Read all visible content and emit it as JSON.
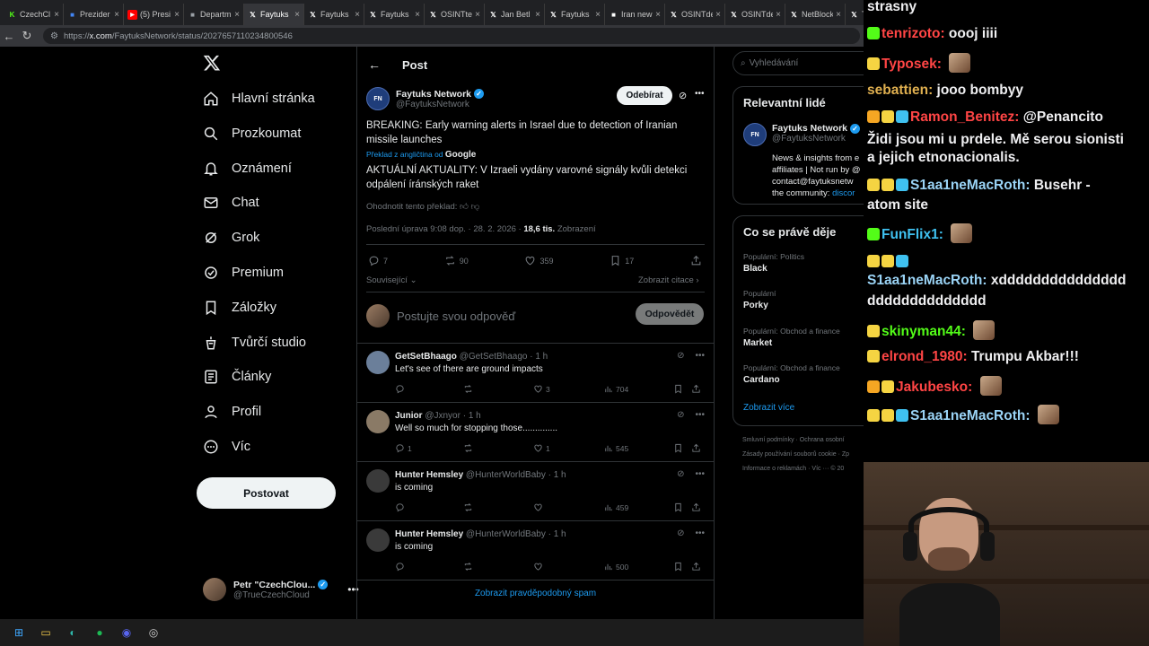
{
  "browser": {
    "tabs": [
      {
        "label": "CzechCl",
        "icon": "kick-icon",
        "color": "#53fc18"
      },
      {
        "label": "Prezider",
        "icon": "app-icon",
        "color": "#4285f4"
      },
      {
        "label": "(5) Presi",
        "icon": "youtube-icon",
        "color": "#ff0000"
      },
      {
        "label": "Departm",
        "icon": "generic-page-icon",
        "color": "#9aa0a6"
      },
      {
        "label": "Faytuks",
        "icon": "x-icon",
        "color": "#ffffff"
      },
      {
        "label": "Faytuks",
        "icon": "x-icon",
        "color": "#ffffff"
      },
      {
        "label": "Faytuks",
        "icon": "x-icon",
        "color": "#ffffff"
      },
      {
        "label": "OSINTte",
        "icon": "x-icon",
        "color": "#ffffff"
      },
      {
        "label": "Jan Betl",
        "icon": "x-icon",
        "color": "#ffffff"
      },
      {
        "label": "Faytuks",
        "icon": "x-icon",
        "color": "#ffffff"
      },
      {
        "label": "Iran new",
        "icon": "news-icon",
        "color": "#ffffff"
      },
      {
        "label": "OSINTde",
        "icon": "x-icon",
        "color": "#ffffff"
      },
      {
        "label": "OSINTde",
        "icon": "x-icon",
        "color": "#ffffff"
      },
      {
        "label": "NetBlock",
        "icon": "x-icon",
        "color": "#ffffff"
      },
      {
        "label": "T",
        "icon": "x-icon",
        "color": "#ffffff"
      }
    ],
    "url_prefix": "https://",
    "url_host": "x.com",
    "url_path": "/FaytuksNetwork/status/2027657110234800546"
  },
  "nav": {
    "items": [
      "Hlavní stránka",
      "Prozkoumat",
      "Oznámení",
      "Chat",
      "Grok",
      "Premium",
      "Záložky",
      "Tvůrčí studio",
      "Články",
      "Profil",
      "Víc"
    ],
    "post_button": "Postovat",
    "user_name": "Petr \"CzechClou...",
    "user_handle": "@TrueCzechCloud"
  },
  "main": {
    "header": "Post",
    "author_name": "Faytuks Network",
    "author_handle": "@FaytuksNetwork",
    "avatar_text": "FN",
    "subscribe": "Odebírat",
    "text": "BREAKING: Early warning alerts in Israel due to detection of Iranian missile launches",
    "translated_from": "Překlad z angličtina od",
    "google": "Google",
    "translation": "AKTUÁLNÍ AKTUALITY: V Izraeli vydány varovné signály kvůli detekci odpálení íránských raket",
    "rate": "Ohodnotit tento překlad:",
    "edited": "Poslední úprava 9:08 dop. · 28. 2. 2026 ·",
    "views": "18,6 tis.",
    "views_label": "Zobrazení",
    "replies": "7",
    "reposts": "90",
    "likes": "359",
    "bookmarks": "17",
    "related": "Související",
    "quotes": "Zobrazit citace",
    "reply_placeholder": "Postujte svou odpověď",
    "reply_button": "Odpovědět",
    "spam": "Zobrazit pravděpodobný spam"
  },
  "replies": [
    {
      "name": "GetSetBhaago",
      "handle": "@GetSetBhaago · 1 h",
      "text": "Let's see of there are ground impacts",
      "replies": "",
      "reposts": "",
      "likes": "3",
      "views": "704"
    },
    {
      "name": "Junior",
      "handle": "@Jxnyor · 1 h",
      "text": "Well so much for stopping those..............",
      "replies": "1",
      "reposts": "",
      "likes": "1",
      "views": "545"
    },
    {
      "name": "Hunter Hemsley",
      "handle": "@HunterWorldBaby · 1 h",
      "text": "is coming",
      "replies": "",
      "reposts": "",
      "likes": "",
      "views": "459"
    },
    {
      "name": "Hunter Hemsley",
      "handle": "@HunterWorldBaby · 1 h",
      "text": "is coming",
      "replies": "",
      "reposts": "",
      "likes": "",
      "views": "500"
    }
  ],
  "right": {
    "search": "Vyhledávání",
    "relevant_title": "Relevantní lidé",
    "rel_name": "Faytuks Network",
    "rel_handle": "@FaytuksNetwork",
    "rel_bio1": "News & insights from e",
    "rel_bio2": "affiliates | Not run by @",
    "rel_bio3": "contact@faytuksnetw",
    "rel_bio4": "the community:",
    "rel_link": "discor",
    "trends_title": "Co se právě děje",
    "trends": [
      {
        "top": "Populární: Politics",
        "name": "Black"
      },
      {
        "top": "Populární",
        "name": "Porky"
      },
      {
        "top": "Populární: Obchod a finance",
        "name": "Market"
      },
      {
        "top": "Populární: Obchod a finance",
        "name": "Cardano"
      }
    ],
    "show_more": "Zobrazit více",
    "footer1": "Smluvní podmínky · Ochrana osobní",
    "footer2": "Zásady používání souborů cookie · Zp",
    "footer3": "Informace o reklamách · Víc ··· © 20"
  },
  "chat": [
    {
      "user": "",
      "color": "#efeff1",
      "msg": "strasny",
      "badges": []
    },
    {
      "user": "tenrizoto",
      "color": "#ff4545",
      "msg": "oooj iiii",
      "badges": [
        "#53fc18"
      ]
    },
    {
      "user": "Typosek",
      "color": "#ff4545",
      "msg": "",
      "badges": [
        "#f5d442"
      ],
      "emote": true
    },
    {
      "user": "sebattien",
      "color": "#e0b050",
      "msg": "jooo bombyy",
      "badges": []
    },
    {
      "user": "Ramon_Benitez",
      "color": "#ff4545",
      "msg": "@Penancito",
      "badges": [
        "#f5a623",
        "#f5d442",
        "#3fc1f0"
      ]
    },
    {
      "user": "",
      "color": "#efeff1",
      "msg": "Židi jsou mi u prdele. Mě serou sionisti",
      "badges": []
    },
    {
      "user": "",
      "color": "#efeff1",
      "msg": "a jejich etnonacionalis.",
      "badges": []
    },
    {
      "user": "S1aa1neMacRoth",
      "color": "#9ad3f5",
      "msg": "Busehr -",
      "badges": [
        "#f5d442",
        "#f5d442",
        "#3fc1f0"
      ]
    },
    {
      "user": "",
      "color": "#efeff1",
      "msg": "atom site",
      "badges": []
    },
    {
      "user": "FunFlix1",
      "color": "#3fc1f0",
      "msg": "",
      "badges": [
        "#53fc18"
      ],
      "emote": true
    },
    {
      "user": "",
      "color": "#efeff1",
      "msg": "",
      "badges": [
        "#f5d442",
        "#f5d442",
        "#3fc1f0"
      ]
    },
    {
      "user": "S1aa1neMacRoth",
      "color": "#9ad3f5",
      "msg": "xddddddddddddddd",
      "badges": []
    },
    {
      "user": "",
      "color": "#efeff1",
      "msg": "dddddddddddddd",
      "badges": []
    },
    {
      "user": "skinyman44",
      "color": "#53fc18",
      "msg": "",
      "badges": [
        "#f5d442"
      ],
      "emote": true
    },
    {
      "user": "elrond_1980",
      "color": "#ff4545",
      "msg": "Trumpu Akbar!!!",
      "badges": [
        "#f5d442"
      ]
    },
    {
      "user": "Jakubesko",
      "color": "#ff4545",
      "msg": "",
      "badges": [
        "#f5a623",
        "#f5d442"
      ],
      "emote": true
    },
    {
      "user": "S1aa1neMacRoth",
      "color": "#9ad3f5",
      "msg": "",
      "badges": [
        "#f5d442",
        "#f5d442",
        "#3fc1f0"
      ],
      "emote": true
    }
  ],
  "taskbar": [
    "windows-start-icon",
    "file-explorer-icon",
    "edge-icon",
    "spotify-icon",
    "discord-icon",
    "obs-icon"
  ]
}
